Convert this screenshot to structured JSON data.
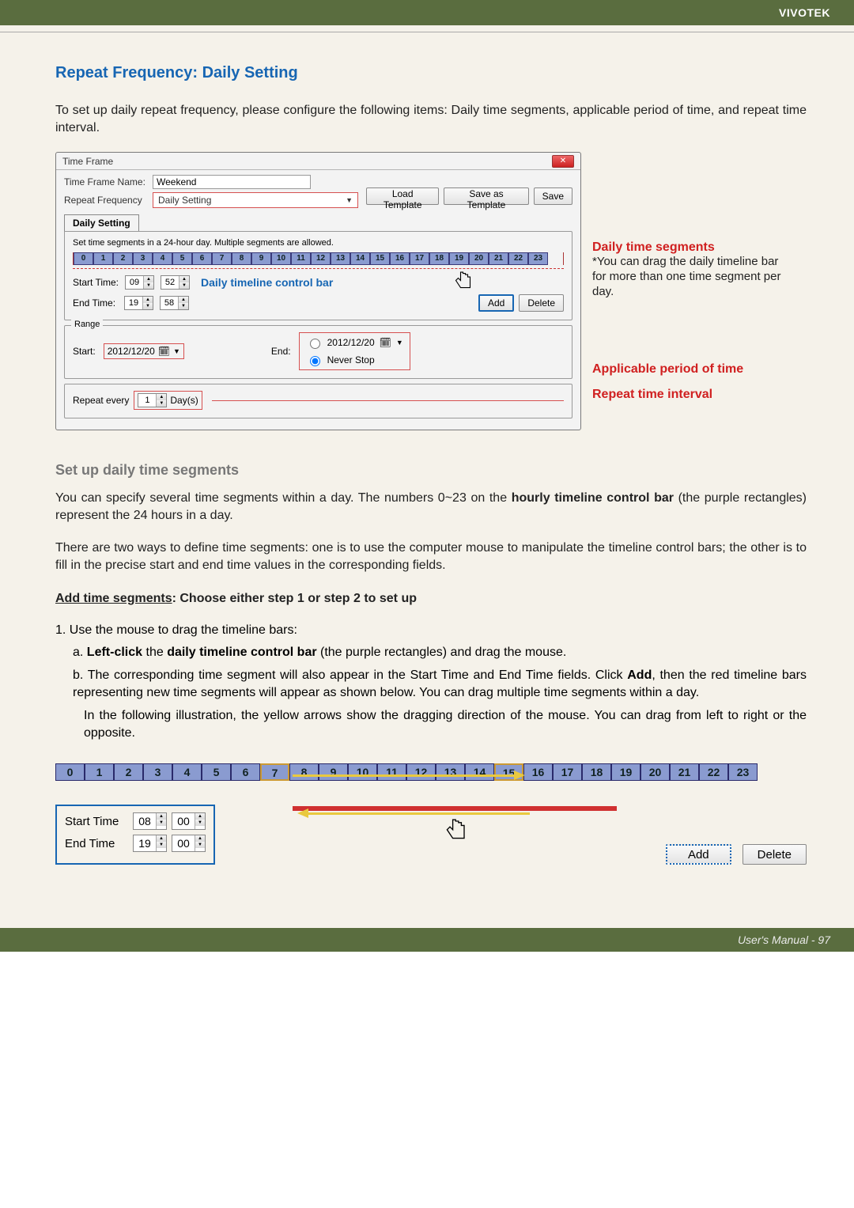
{
  "brand": "VIVOTEK",
  "heading_main": "Repeat Frequency: Daily Setting",
  "intro_text": "To set up daily repeat frequency, please configure the following items: Daily time segments, applicable period of time, and repeat time interval.",
  "dialog": {
    "title": "Time Frame",
    "name_label": "Time Frame Name:",
    "name_value": "Weekend",
    "buttons": {
      "load": "Load Template",
      "save_as": "Save as Template",
      "save": "Save"
    },
    "freq_label": "Repeat Frequency",
    "freq_value": "Daily Setting",
    "tab_label": "Daily Setting",
    "daily": {
      "desc": "Set time segments in a 24-hour day. Multiple segments are allowed.",
      "hours": [
        "0",
        "1",
        "2",
        "3",
        "4",
        "5",
        "6",
        "7",
        "8",
        "9",
        "10",
        "11",
        "12",
        "13",
        "14",
        "15",
        "16",
        "17",
        "18",
        "19",
        "20",
        "21",
        "22",
        "23"
      ],
      "start_label": "Start Time:",
      "end_label": "End Time:",
      "start_hh": "09",
      "start_mm": "52",
      "end_hh": "19",
      "end_mm": "58",
      "control_bar_label": "Daily timeline control bar",
      "add": "Add",
      "delete": "Delete"
    },
    "range": {
      "legend": "Range",
      "start_label": "Start:",
      "start_val": "2012/12/20",
      "end_label": "End:",
      "end_val": "2012/12/20",
      "never": "Never Stop"
    },
    "repeat": {
      "prefix": "Repeat every",
      "val": "1",
      "unit": "Day(s)"
    }
  },
  "annotations": {
    "seg_title": "Daily time segments",
    "seg_body": "*You can drag the daily timeline bar for more than one time segment per day.",
    "range_title": "Applicable period of time",
    "repeat_title": "Repeat time interval"
  },
  "sect2_title": "Set up daily time segments",
  "sect2_p1a": "You can specify several time segments within a day. The numbers 0~23 on the ",
  "sect2_p1b": "hourly timeline control bar",
  "sect2_p1c": " (the purple rectangles) represent the 24 hours in a day.",
  "sect2_p2": "There are two ways to define time segments: one is to use the computer mouse to manipulate the timeline control bars; the other is to fill in the precise start and end time values in the corresponding fields.",
  "add_seg_title": "Add time segments",
  "add_seg_rest": ": Choose either step 1 or step 2 to set up",
  "step1": "1. Use the mouse to drag the timeline bars:",
  "step1a_pre": "a. ",
  "step1a_lc": "Left-click",
  "step1a_mid": " the ",
  "step1a_bar": "daily timeline control bar",
  "step1a_post": " (the purple rectangles) and drag the mouse.",
  "step1b_pre": "b. The corresponding time segment will also appear in the Start Time and End Time fields. Click ",
  "step1b_add": "Add",
  "step1b_post": ", then the red timeline bars representing new time segments will appear as shown below. You can drag multiple time segments within a day.",
  "step1b_cont": "In the following illustration, the yellow arrows show the dragging direction of the mouse. You can drag from left to right or the opposite.",
  "big": {
    "hours": [
      "0",
      "1",
      "2",
      "3",
      "4",
      "5",
      "6",
      "7",
      "8",
      "9",
      "10",
      "11",
      "12",
      "13",
      "14",
      "15",
      "16",
      "17",
      "18",
      "19",
      "20",
      "21",
      "22",
      "23"
    ],
    "start_label": "Start Time",
    "end_label": "End Time",
    "start_hh": "08",
    "start_mm": "00",
    "end_hh": "19",
    "end_mm": "00",
    "add": "Add",
    "delete": "Delete"
  },
  "footer": "User's Manual - 97"
}
